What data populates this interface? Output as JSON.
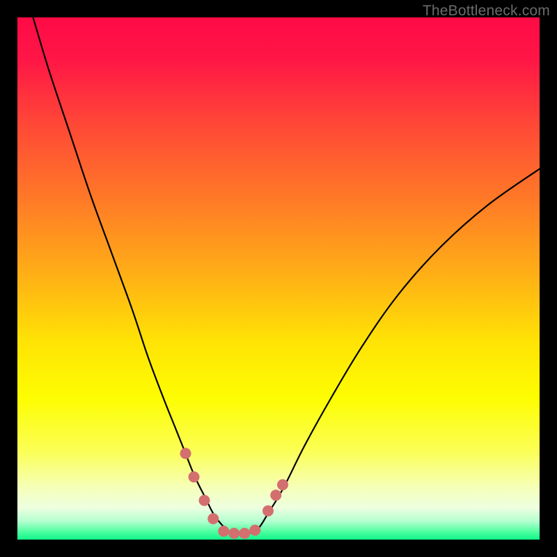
{
  "watermark": {
    "text": "TheBottleneck.com"
  },
  "gradient": {
    "stops": [
      {
        "offset": 0.0,
        "color": "#ff0a46"
      },
      {
        "offset": 0.08,
        "color": "#ff1646"
      },
      {
        "offset": 0.2,
        "color": "#ff4637"
      },
      {
        "offset": 0.35,
        "color": "#ff7a27"
      },
      {
        "offset": 0.5,
        "color": "#ffb215"
      },
      {
        "offset": 0.62,
        "color": "#ffe305"
      },
      {
        "offset": 0.73,
        "color": "#fdfd02"
      },
      {
        "offset": 0.83,
        "color": "#fbff55"
      },
      {
        "offset": 0.9,
        "color": "#f6ffb8"
      },
      {
        "offset": 0.94,
        "color": "#ecffe0"
      },
      {
        "offset": 0.965,
        "color": "#b3ffcf"
      },
      {
        "offset": 0.985,
        "color": "#4effa0"
      },
      {
        "offset": 1.0,
        "color": "#12f58a"
      }
    ]
  },
  "chart_data": {
    "type": "line",
    "title": "",
    "xlabel": "",
    "ylabel": "",
    "xlim": [
      0,
      100
    ],
    "ylim": [
      0,
      100
    ],
    "series": [
      {
        "name": "bottleneck-curve",
        "x": [
          3,
          6,
          10,
          14,
          18,
          22,
          25,
          28,
          30,
          32,
          34,
          36,
          37.5,
          39,
          40.5,
          42,
          44,
          46,
          48,
          51,
          55,
          60,
          66,
          73,
          81,
          90,
          100
        ],
        "y": [
          100,
          90,
          78,
          66,
          55,
          44,
          35,
          27,
          22,
          17,
          12,
          8,
          5,
          3,
          1.6,
          1.2,
          1.2,
          2,
          5,
          10,
          18,
          27,
          37,
          47,
          56,
          64,
          71
        ]
      }
    ],
    "markers": {
      "color": "#d36f6f",
      "radius_px": 8,
      "points": [
        {
          "x": 32.2,
          "y": 16.5
        },
        {
          "x": 33.8,
          "y": 12.0
        },
        {
          "x": 35.8,
          "y": 7.5
        },
        {
          "x": 37.5,
          "y": 4.0
        },
        {
          "x": 39.5,
          "y": 1.6
        },
        {
          "x": 41.5,
          "y": 1.2
        },
        {
          "x": 43.5,
          "y": 1.2
        },
        {
          "x": 45.5,
          "y": 1.8
        },
        {
          "x": 48.0,
          "y": 5.5
        },
        {
          "x": 49.5,
          "y": 8.5
        },
        {
          "x": 50.8,
          "y": 10.5
        }
      ]
    }
  }
}
